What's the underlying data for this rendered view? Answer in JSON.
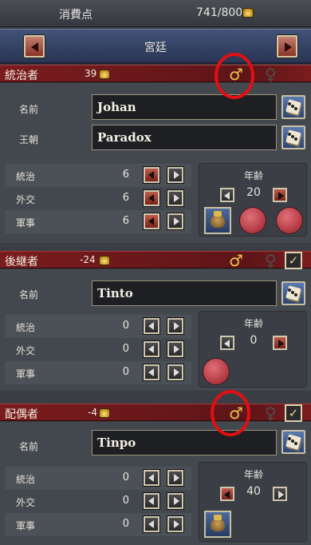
{
  "top": {
    "cost_label": "消費点",
    "cost_value": "741/800",
    "icon": "crown-icon"
  },
  "tab": {
    "title": "宮廷"
  },
  "ruler": {
    "title": "統治者",
    "cost": "39",
    "gender_icons": [
      "male-icon",
      "female-icon"
    ],
    "name_label": "名前",
    "name_value": "Johan",
    "dynasty_label": "王朝",
    "dynasty_value": "Paradox",
    "stats": [
      {
        "label": "統治",
        "value": "6"
      },
      {
        "label": "外交",
        "value": "6"
      },
      {
        "label": "軍事",
        "value": "6"
      }
    ],
    "age_label": "年齢",
    "age_value": "20"
  },
  "heir": {
    "title": "後継者",
    "cost": "-24",
    "checkbox": "✓",
    "name_label": "名前",
    "name_value": "Tinto",
    "stats": [
      {
        "label": "統治",
        "value": "0"
      },
      {
        "label": "外交",
        "value": "0"
      },
      {
        "label": "軍事",
        "value": "0"
      }
    ],
    "age_label": "年齢",
    "age_value": "0"
  },
  "consort": {
    "title": "配偶者",
    "cost": "-4",
    "checkbox": "✓",
    "name_label": "名前",
    "name_value": "Tinpo",
    "stats": [
      {
        "label": "統治",
        "value": "0"
      },
      {
        "label": "外交",
        "value": "0"
      },
      {
        "label": "軍事",
        "value": "0"
      }
    ],
    "age_label": "年齢",
    "age_value": "40"
  },
  "colors": {
    "header_red": "#7a1c1e",
    "accent_gold": "#e8c24a",
    "highlight_circle": "#e20f12",
    "tab_blue": "#41527a"
  }
}
